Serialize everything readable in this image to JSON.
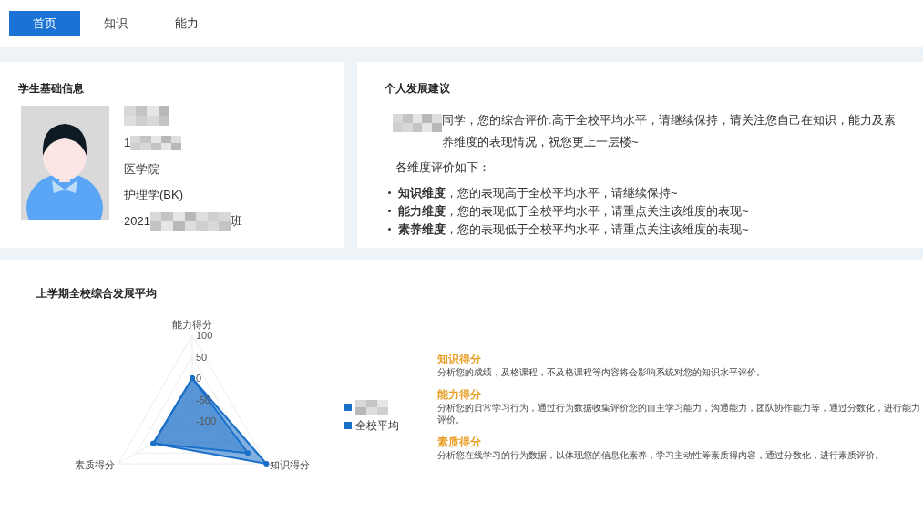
{
  "tabs": [
    {
      "label": "首页",
      "selected": true
    },
    {
      "label": "知识",
      "selected": false
    },
    {
      "label": "能力",
      "selected": false
    }
  ],
  "student_info": {
    "title": "学生基础信息",
    "id_prefix": "1",
    "college": "医学院",
    "major": "护理学(BK)",
    "class_prefix": "2021",
    "class_suffix": "班"
  },
  "advice": {
    "title": "个人发展建议",
    "summary": "同学，您的综合评价:高于全校平均水平，请继续保持，请关注您自己在知识，能力及素养维度的表现情况，祝您更上一层楼~",
    "intro": "各维度评价如下：",
    "items": [
      "**知识维度**，您的表现高于全校平均水平，请继续保持~",
      "**能力维度**，您的表现低于全校平均水平，请重点关注该维度的表现~",
      "**素养维度**，您的表现低于全校平均水平，请重点关注该维度的表现~"
    ]
  },
  "average": {
    "title": "上学期全校综合发展平均",
    "chart_data": {
      "type": "radar",
      "categories": [
        "能力得分",
        "知识得分",
        "素质得分"
      ],
      "ylim": [
        -100,
        100
      ],
      "yticks": [
        100,
        50,
        0,
        -50,
        -100
      ],
      "series": [
        {
          "color": "#1a6fc9",
          "values": [
            0,
            100,
            5
          ]
        },
        {
          "name": "全校平均",
          "color": "#1a6fc9",
          "values": [
            0,
            50,
            5
          ]
        }
      ]
    },
    "descriptions": [
      {
        "title": "知识得分",
        "text": "分析您的成绩，及格课程，不及格课程等内容将会影响系统对您的知识水平评价。"
      },
      {
        "title": "能力得分",
        "text": "分析您的日常学习行为，通过行为数据收集评价您的自主学习能力，沟通能力，团队协作能力等，通过分数化，进行能力评价。"
      },
      {
        "title": "素质得分",
        "text": "分析您在线学习的行为数据，以体现您的信息化素养，学习主动性等素质得内容，通过分数化，进行素质评价。"
      }
    ]
  }
}
